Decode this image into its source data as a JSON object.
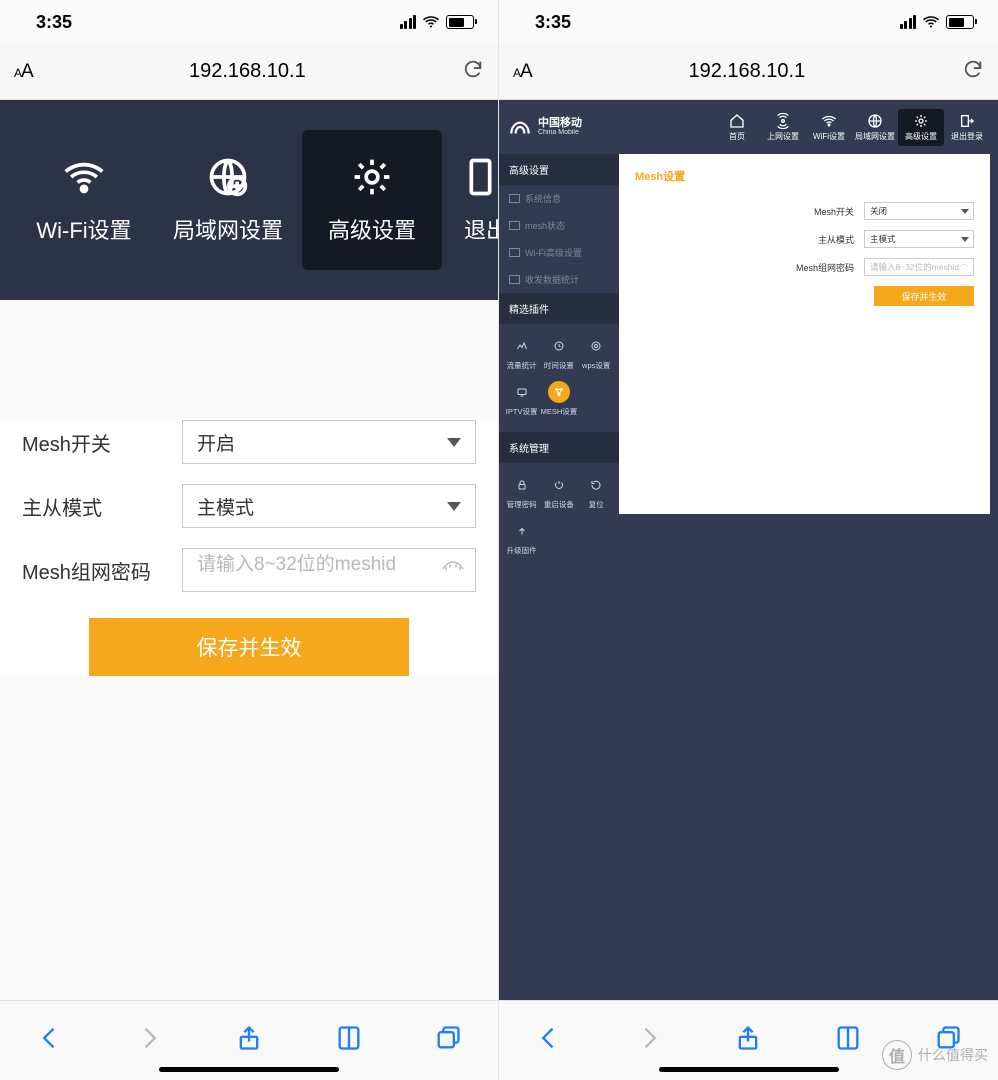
{
  "status": {
    "time": "3:35"
  },
  "browser": {
    "url": "192.168.10.1",
    "toolbar": {
      "back": "后退",
      "forward": "前进",
      "share": "分享",
      "bookmarks": "书签",
      "tabs": "标签页"
    }
  },
  "left": {
    "nav": {
      "wifi": "Wi-Fi设置",
      "lan": "局域网设置",
      "advanced": "高级设置",
      "logout": "退出"
    },
    "form": {
      "mesh_switch_label": "Mesh开关",
      "mesh_switch_value": "开启",
      "mode_label": "主从模式",
      "mode_value": "主模式",
      "pwd_label": "Mesh组网密码",
      "pwd_placeholder": "请输入8~32位的meshid",
      "save": "保存并生效"
    }
  },
  "right": {
    "brand": {
      "cn": "中国移动",
      "en": "China Mobile"
    },
    "topnav": {
      "home": "首页",
      "wan": "上网设置",
      "wifi": "WiFi设置",
      "lan": "局域网设置",
      "advanced": "高级设置",
      "logout": "退出登录"
    },
    "sidebar": {
      "advanced_header": "高级设置",
      "items": [
        "系统信息",
        "mesh状态",
        "Wi-Fi高级设置",
        "收发数据统计"
      ],
      "plugins_header": "精选插件",
      "plugins": [
        "流量统计",
        "时间设置",
        "wps设置",
        "IPTV设置",
        "MESH设置"
      ],
      "sys_header": "系统管理",
      "sys": [
        "管理密码",
        "重启设备",
        "复位",
        "升级固件"
      ]
    },
    "content": {
      "title": "Mesh设置",
      "mesh_switch_label": "Mesh开关",
      "mesh_switch_value": "关闭",
      "mode_label": "主从模式",
      "mode_value": "主模式",
      "pwd_label": "Mesh组网密码",
      "pwd_placeholder": "请输入8~32位的meshid",
      "save": "保存并生效"
    }
  },
  "watermark": "什么值得买"
}
